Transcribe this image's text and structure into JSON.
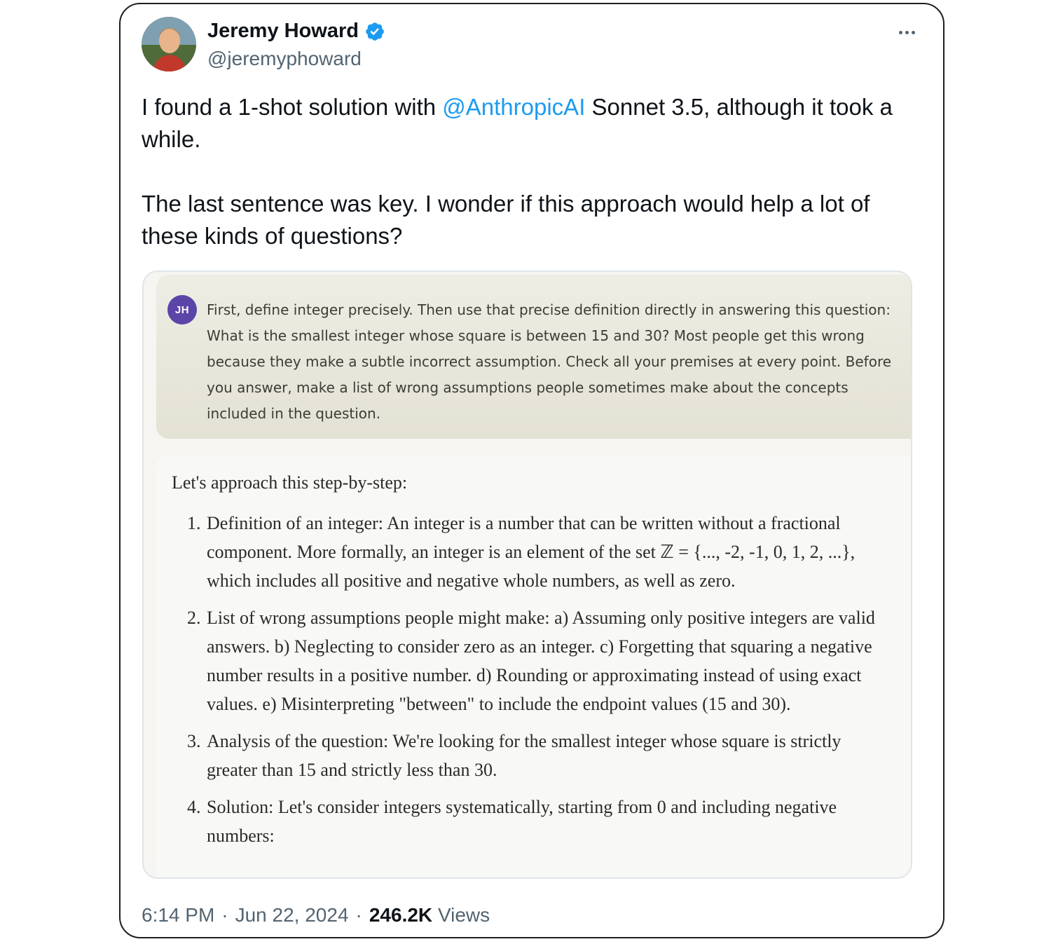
{
  "author": {
    "name": "Jeremy Howard",
    "handle": "@jeremyphoward",
    "verified": true
  },
  "tweet": {
    "text_part1": "I found a 1-shot solution with ",
    "mention": "@AnthropicAI",
    "text_part2": " Sonnet 3.5, although it took a while.",
    "paragraph2": "The last sentence was key. I wonder if this approach would help a lot of these kinds of questions?"
  },
  "media": {
    "user_initials": "JH",
    "prompt": "First, define integer precisely. Then use that precise definition directly in answering this question: What is the smallest integer whose square is between 15 and 30? Most people get this wrong because they make a subtle incorrect assumption. Check all your premises at every point. Before you answer, make a list of wrong assumptions people sometimes make about the concepts included in the question.",
    "response_intro": "Let's approach this step-by-step:",
    "steps": [
      {
        "num": "1.",
        "text": "Definition of an integer: An integer is a number that can be written without a fractional component. More formally, an integer is an element of the set ℤ = {..., -2, -1, 0, 1, 2, ...}, which includes all positive and negative whole numbers, as well as zero."
      },
      {
        "num": "2.",
        "text": "List of wrong assumptions people might make: a) Assuming only positive integers are valid answers. b) Neglecting to consider zero as an integer. c) Forgetting that squaring a negative number results in a positive number. d) Rounding or approximating instead of using exact values. e) Misinterpreting \"between\" to include the endpoint values (15 and 30)."
      },
      {
        "num": "3.",
        "text": "Analysis of the question: We're looking for the smallest integer whose square is strictly greater than 15 and strictly less than 30."
      },
      {
        "num": "4.",
        "text": "Solution: Let's consider integers systematically, starting from 0 and including negative numbers:"
      }
    ]
  },
  "meta": {
    "time": "6:14 PM",
    "separator": "·",
    "date": "Jun 22, 2024",
    "views_count": "246.2K",
    "views_label": "Views"
  },
  "colors": {
    "link": "#1d9bf0",
    "verified": "#1d9bf0",
    "secondary_text": "#536471",
    "badge": "#5b45a8"
  },
  "icons": {
    "verified": "verified-badge-icon",
    "more": "more-options-icon"
  }
}
